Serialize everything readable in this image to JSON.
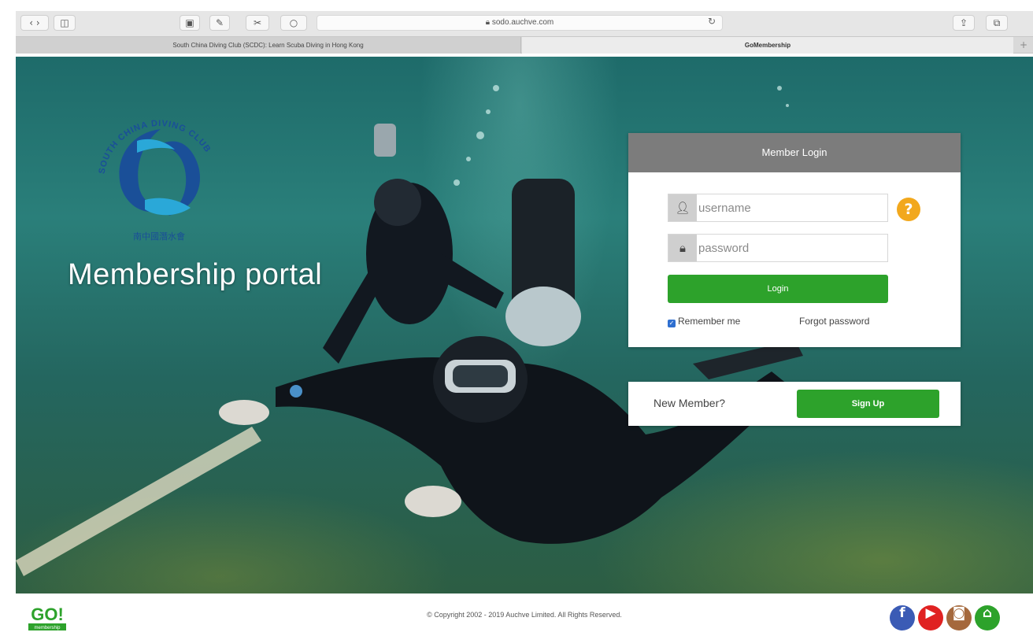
{
  "browser": {
    "address": "sodo.auchve.com",
    "tabs": [
      {
        "label": "South China Diving Club (SCDC): Learn Scuba Diving in Hong Kong"
      },
      {
        "label": "GoMembership"
      }
    ],
    "new_tab_label": "+"
  },
  "hero": {
    "logo_ring_text": "SOUTH CHINA DIVING CLUB",
    "logo_chinese_text": "南中國潛水會",
    "title": "Membership portal"
  },
  "login": {
    "header": "Member Login",
    "username_placeholder": "username",
    "password_placeholder": "password",
    "help_label": "?",
    "login_label": "Login",
    "remember_label": "Remember me",
    "forgot_label": "Forgot password"
  },
  "signup": {
    "prompt": "New Member?",
    "button_label": "Sign Up"
  },
  "footer": {
    "go_logo_text": "GO!",
    "go_logo_sub": "membership",
    "copyright": "© Copyright 2002 - 2019 Auchve Limited. All Rights Reserved.",
    "social": [
      "facebook",
      "youtube",
      "instagram",
      "home"
    ]
  },
  "colors": {
    "accent_green": "#2da22b",
    "header_gray": "#7c7c7c",
    "help_orange": "#f2a81d",
    "logo_blue": "#1a4f98"
  }
}
